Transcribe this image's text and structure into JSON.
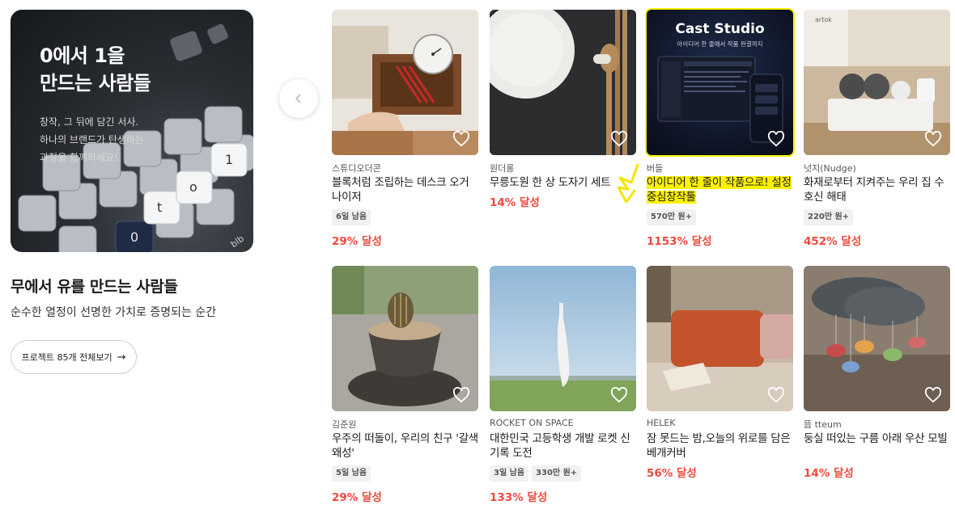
{
  "promo": {
    "title": "0에서 1을\n만드는 사람들",
    "description": "창작, 그 뒤에 담긴 서사.\n하나의 브랜드가 탄생하는\n과정을 함께하세요!",
    "key_labels": [
      "0",
      "t",
      "o",
      "1"
    ],
    "logo_text": "blb"
  },
  "section": {
    "title": "무에서 유를 만드는 사람들",
    "subtitle": "순수한 열정이 선명한 가치로 증명되는 순간",
    "view_all_label": "프로젝트 85개 전체보기",
    "view_all_icon": "arrow-right-icon"
  },
  "carousel": {
    "prev_icon": "chevron-left-icon"
  },
  "cast_studio": {
    "title": "Cast Studio",
    "subtitle": "아이디어 한 줄에서 작품 완결까지"
  },
  "artok_label": "artok",
  "highlight_color": "#fff200",
  "accent_color": "#f0483e",
  "products": [
    {
      "maker": "스튜디오더콘",
      "title": "블록처럼 조립하는 데스크 오거나이저",
      "tags": [
        "6일 남음"
      ],
      "rate": "29% 달성",
      "image": "wooden-desk-organizer"
    },
    {
      "maker": "원더롱",
      "title": "무릉도원 한 상 도자기 세트",
      "tags": [],
      "rate": "14% 달성",
      "image": "ceramic-plate-set"
    },
    {
      "maker": "버들",
      "title": "아이디어 한 줄이 작품으로! 설정중심창작툴",
      "tags": [
        "570만 원+"
      ],
      "rate": "1153% 달성",
      "image": "cast-studio-app",
      "highlighted": true
    },
    {
      "maker": "넛지(Nudge)",
      "title": "화재로부터 지켜주는 우리 집 수호신 해태",
      "tags": [
        "220만 원+"
      ],
      "rate": "452% 달성",
      "image": "haetae-power-strip"
    },
    {
      "maker": "김준원",
      "title": "우주의 떠돌이, 우리의 친구 '갈색 왜성'",
      "tags": [
        "5일 남음"
      ],
      "rate": "29% 달성",
      "image": "cactus-pot"
    },
    {
      "maker": "ROCKET ON SPACE",
      "title": "대한민국 고등학생 개발 로켓 신기록 도전",
      "tags": [
        "3일 남음",
        "330만 원+"
      ],
      "rate": "133% 달성",
      "image": "rocket-launch"
    },
    {
      "maker": "HELEK",
      "title": "잠 못드는 밤,오늘의 위로를 담은 베개커버",
      "tags": [],
      "rate": "56% 달성",
      "image": "pillow-cover"
    },
    {
      "maker": "뜸 tteum",
      "title": "둥실 떠있는 구름 아래 우산 모빌",
      "tags": [],
      "rate": "14% 달성",
      "image": "cloud-mobile"
    }
  ]
}
